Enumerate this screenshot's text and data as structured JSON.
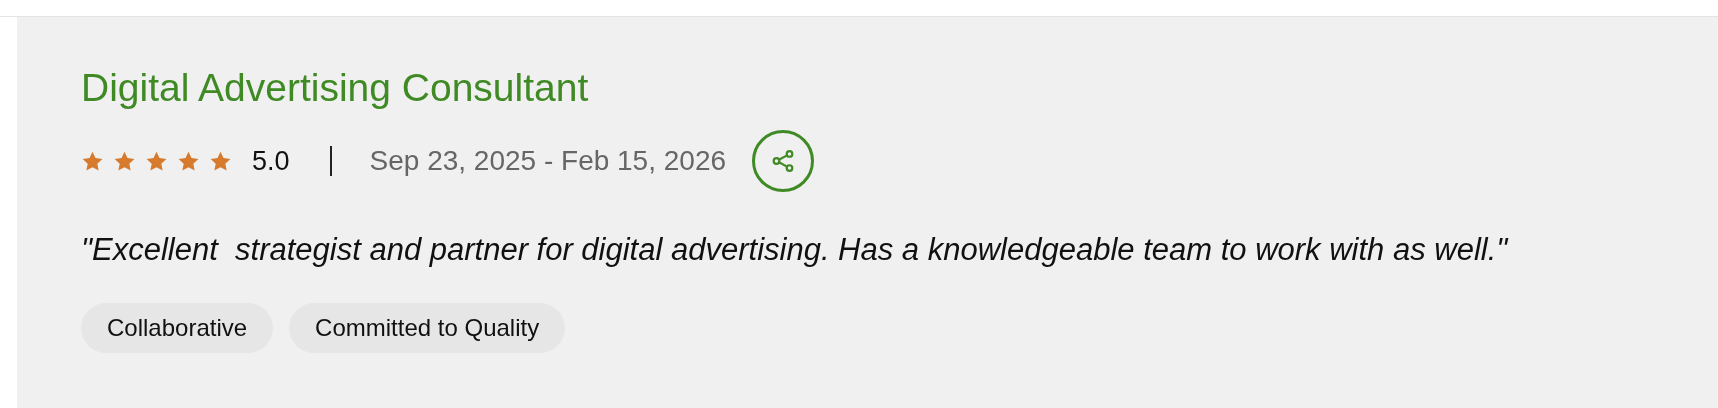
{
  "review": {
    "title": "Digital Advertising Consultant",
    "stars": 5,
    "rating": "5.0",
    "dates": "Sep 23, 2025 - Feb 15, 2026",
    "quote": "\"Excellent  strategist and partner for digital advertising. Has a knowledgeable team to work with as well.\"",
    "tags": [
      "Collaborative",
      "Committed to Quality"
    ]
  }
}
